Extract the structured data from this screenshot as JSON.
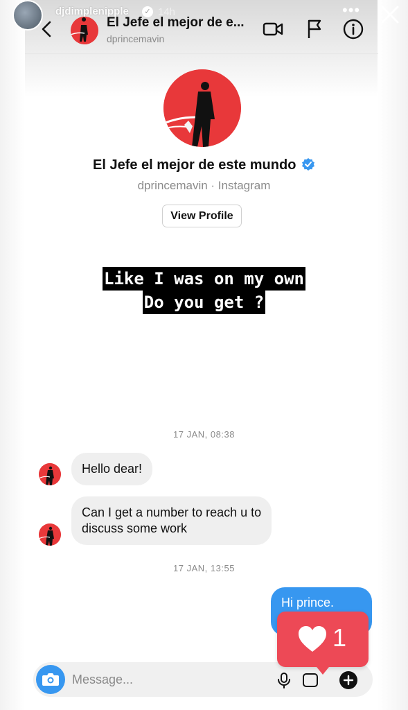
{
  "story": {
    "username": "djdimplenipple",
    "time_ago": "14h",
    "more_icon": "more-icon",
    "close_icon": "close-icon"
  },
  "dm_header": {
    "name": "El Jefe el mejor de e...",
    "username": "dprincemavin",
    "icons": [
      "back-arrow-icon",
      "video-call-icon",
      "flag-icon",
      "info-icon"
    ]
  },
  "profile": {
    "display_name": "El Jefe el mejor de este mundo",
    "subtitle": "dprincemavin · Instagram",
    "view_profile_label": "View Profile"
  },
  "caption": {
    "line1": "Like I was on my own",
    "line2": "Do you get ?"
  },
  "messages": {
    "timestamp1": "17 JAN, 08:38",
    "incoming": [
      {
        "line1": "Hello dear!",
        "line2": ""
      },
      {
        "line1": "Can I get a number to reach u to",
        "line2": "discuss some work"
      }
    ],
    "timestamp2": "17 JAN, 13:55",
    "outgoing": "Hi prince."
  },
  "composer": {
    "placeholder": "Message..."
  },
  "like_sticker": {
    "count": "1"
  },
  "colors": {
    "accent_blue": "#3797f0",
    "like_red": "#ed4956",
    "avatar_red": "#e8383a",
    "verified_blue": "#3897f0"
  }
}
